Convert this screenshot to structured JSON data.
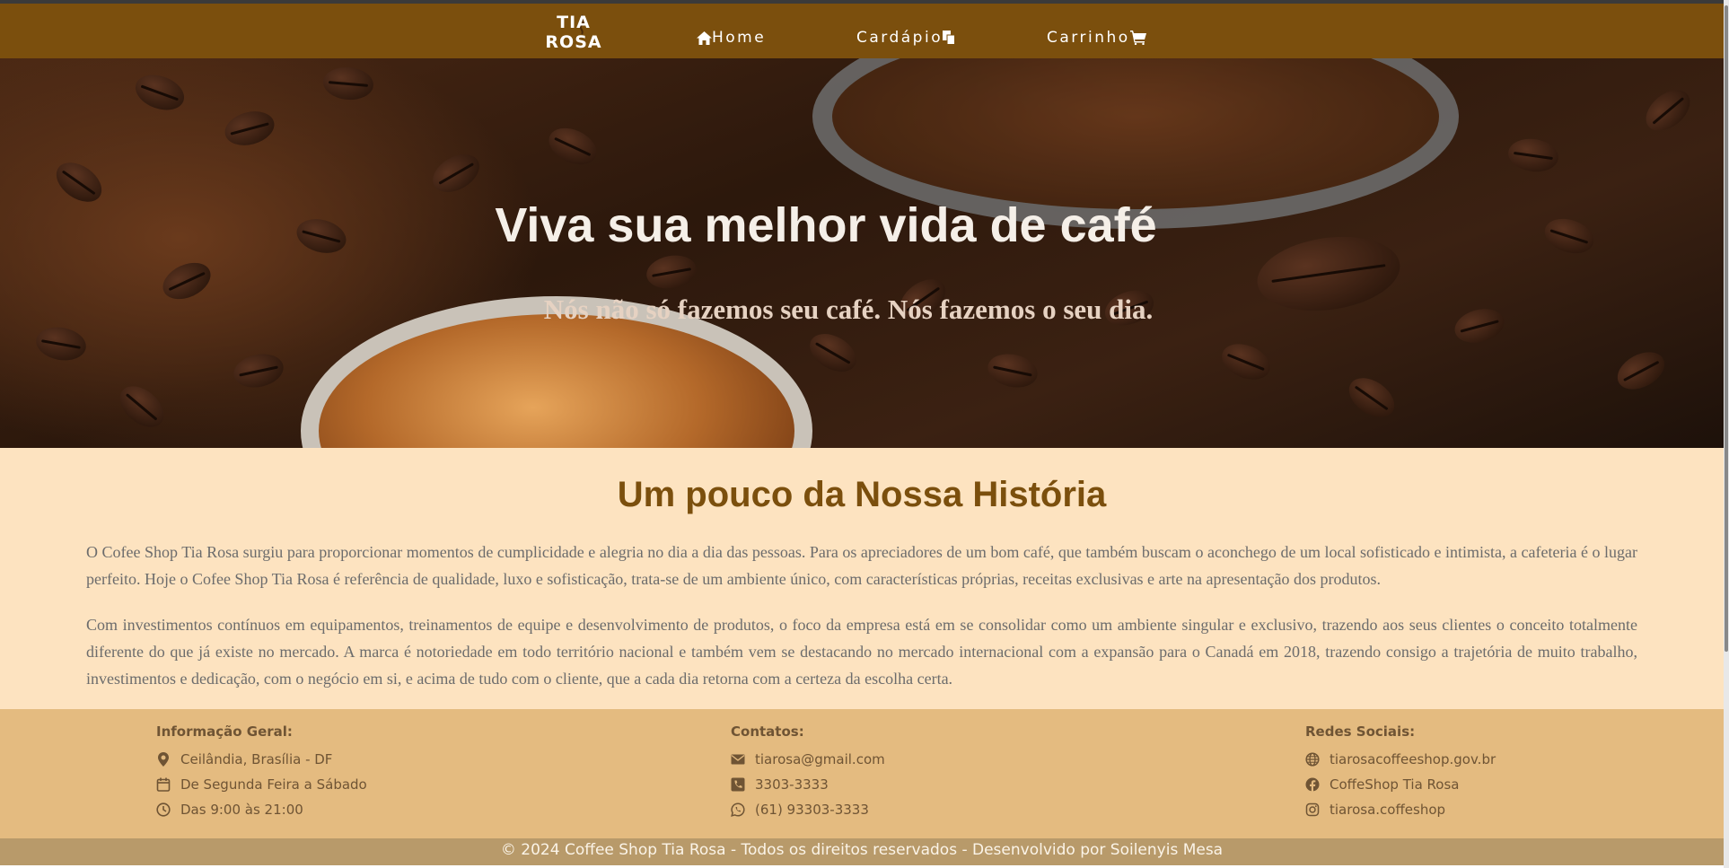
{
  "nav": {
    "logo_text": "TIA ROSA",
    "items": [
      {
        "label": "Home",
        "icon": "home-icon"
      },
      {
        "label": "Cardápio",
        "icon": "copy-icon"
      },
      {
        "label": "Carrinho",
        "icon": "cart-icon"
      }
    ]
  },
  "hero": {
    "title": "Viva sua melhor vida de café",
    "subtitle": "Nós não só fazemos seu café. Nós fazemos o seu dia."
  },
  "history": {
    "title": "Um pouco da Nossa História",
    "paragraphs": [
      "O Cofee Shop Tia Rosa surgiu para proporcionar momentos de cumplicidade e alegria no dia a dia das pessoas. Para os apreciadores de um bom café, que também buscam o aconchego de um local sofisticado e intimista, a cafeteria é o lugar perfeito. Hoje o Cofee Shop Tia Rosa é referência de qualidade, luxo e sofisticação, trata-se de um ambiente único, com características próprias, receitas exclusivas e arte na apresentação dos produtos.",
      "Com investimentos contínuos em equipamentos, treinamentos de equipe e desenvolvimento de produtos, o foco da empresa está em se consolidar como um ambiente singular e exclusivo, trazendo aos seus clientes o conceito totalmente diferente do que já existe no mercado. A marca é notoriedade em todo território nacional e também vem se destacando no mercado internacional com a expansão para o Canadá em 2018, trazendo consigo a trajetória de muito trabalho, investimentos e dedicação, com o negócio em si, e acima de tudo com o cliente, que a cada dia retorna com a certeza da escolha certa."
    ]
  },
  "footer": {
    "columns": [
      {
        "title": "Informação Geral:",
        "rows": [
          {
            "icon": "location-pin-icon",
            "text": "Ceilândia, Brasília - DF"
          },
          {
            "icon": "calendar-icon",
            "text": "De Segunda Feira a Sábado"
          },
          {
            "icon": "clock-icon",
            "text": "Das 9:00 às 21:00"
          }
        ]
      },
      {
        "title": "Contatos:",
        "rows": [
          {
            "icon": "envelope-icon",
            "text": "tiarosa@gmail.com"
          },
          {
            "icon": "phone-icon",
            "text": "3303-3333"
          },
          {
            "icon": "whatsapp-icon",
            "text": "(61) 93303-3333"
          }
        ]
      },
      {
        "title": "Redes Sociais:",
        "rows": [
          {
            "icon": "globe-icon",
            "text": "tiarosacoffeeshop.gov.br"
          },
          {
            "icon": "facebook-icon",
            "text": "CoffeShop Tia Rosa"
          },
          {
            "icon": "instagram-icon",
            "text": "tiarosa.coffeshop"
          }
        ]
      }
    ],
    "copyright": "© 2024 Coffee Shop Tia Rosa - Todos os direitos reservados - Desenvolvido por Soilenyis Mesa"
  },
  "colors": {
    "nav_bg": "#7b4f0d",
    "history_bg": "#fde3c0",
    "footer_bg": "#e4bb80",
    "copyright_bg": "#b89a6a",
    "accent_brown": "#7b4f0d"
  }
}
